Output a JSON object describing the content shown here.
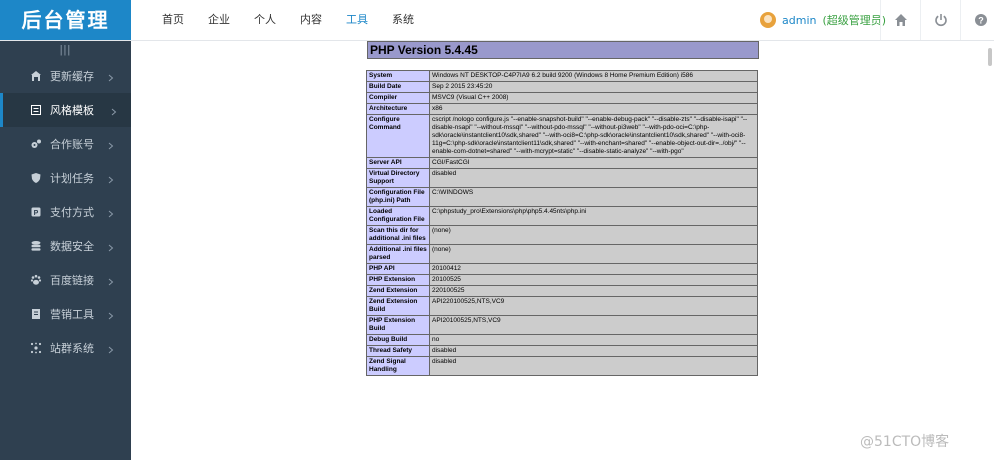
{
  "app": {
    "logo": "后台管理"
  },
  "nav": {
    "items": [
      "首页",
      "企业",
      "个人",
      "内容",
      "工具",
      "系统"
    ],
    "active_index": 4
  },
  "user": {
    "name": "admin",
    "role": "(超级管理员)"
  },
  "sidebar": {
    "collapse_icon": "|||",
    "items": [
      {
        "label": "更新缓存",
        "icon": "house-icon"
      },
      {
        "label": "风格模板",
        "icon": "list-icon",
        "active": true
      },
      {
        "label": "合作账号",
        "icon": "gears-icon"
      },
      {
        "label": "计划任务",
        "icon": "shield-icon"
      },
      {
        "label": "支付方式",
        "icon": "pay-icon"
      },
      {
        "label": "数据安全",
        "icon": "database-icon"
      },
      {
        "label": "百度链接",
        "icon": "paw-icon"
      },
      {
        "label": "营销工具",
        "icon": "book-icon"
      },
      {
        "label": "站群系统",
        "icon": "network-icon"
      }
    ]
  },
  "phpinfo": {
    "title": "PHP Version 5.4.45",
    "rows": [
      {
        "key": "System",
        "value": "Windows NT DESKTOP-C4P7IA9 6.2 build 9200 (Windows 8 Home Premium Edition) i586"
      },
      {
        "key": "Build Date",
        "value": "Sep 2 2015 23:45:20"
      },
      {
        "key": "Compiler",
        "value": "MSVC9 (Visual C++ 2008)"
      },
      {
        "key": "Architecture",
        "value": "x86"
      },
      {
        "key": "Configure Command",
        "value": "cscript /nologo configure.js \"--enable-snapshot-build\" \"--enable-debug-pack\" \"--disable-zts\" \"--disable-isapi\" \"--disable-nsapi\" \"--without-mssql\" \"--without-pdo-mssql\" \"--without-pi3web\" \"--with-pdo-oci=C:\\php-sdk\\oracle\\instantclient10\\sdk,shared\" \"--with-oci8=C:\\php-sdk\\oracle\\instantclient10\\sdk,shared\" \"--with-oci8-11g=C:\\php-sdk\\oracle\\instantclient11\\sdk,shared\" \"--with-enchant=shared\" \"--enable-object-out-dir=../obj/\" \"--enable-com-dotnet=shared\" \"--with-mcrypt=static\" \"--disable-static-analyze\" \"--with-pgo\""
      },
      {
        "key": "Server API",
        "value": "CGI/FastCGI"
      },
      {
        "key": "Virtual Directory Support",
        "value": "disabled"
      },
      {
        "key": "Configuration File (php.ini) Path",
        "value": "C:\\WINDOWS"
      },
      {
        "key": "Loaded Configuration File",
        "value": "C:\\phpstudy_pro\\Extensions\\php\\php5.4.45nts\\php.ini"
      },
      {
        "key": "Scan this dir for additional .ini files",
        "value": "(none)"
      },
      {
        "key": "Additional .ini files parsed",
        "value": "(none)"
      },
      {
        "key": "PHP API",
        "value": "20100412"
      },
      {
        "key": "PHP Extension",
        "value": "20100525"
      },
      {
        "key": "Zend Extension",
        "value": "220100525"
      },
      {
        "key": "Zend Extension Build",
        "value": "API220100525,NTS,VC9"
      },
      {
        "key": "PHP Extension Build",
        "value": "API20100525,NTS,VC9"
      },
      {
        "key": "Debug Build",
        "value": "no"
      },
      {
        "key": "Thread Safety",
        "value": "disabled"
      },
      {
        "key": "Zend Signal Handling",
        "value": "disabled"
      }
    ]
  },
  "watermark": "@51CTO博客",
  "colors": {
    "brand": "#1d87c8",
    "sidebar_bg": "#2f4050",
    "role": "#3aa142"
  }
}
